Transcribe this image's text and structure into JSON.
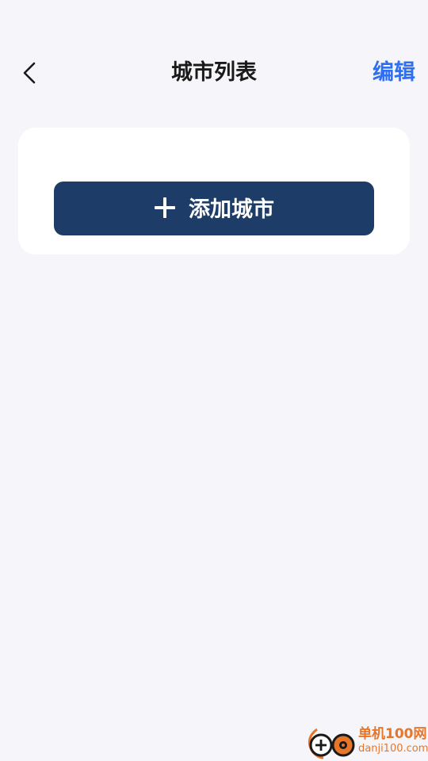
{
  "header": {
    "back_icon": "chevron-left-icon",
    "title": "城市列表",
    "edit_label": "编辑"
  },
  "card": {
    "add_icon": "plus-icon",
    "add_label": "添加城市"
  },
  "watermark": {
    "name": "单机100网",
    "domain": "danji100.com"
  },
  "colors": {
    "background": "#f5f5fa",
    "card": "#ffffff",
    "primary_button": "#1d3d68",
    "edit_accent": "#2f6ff2",
    "watermark": "#e8762a"
  }
}
